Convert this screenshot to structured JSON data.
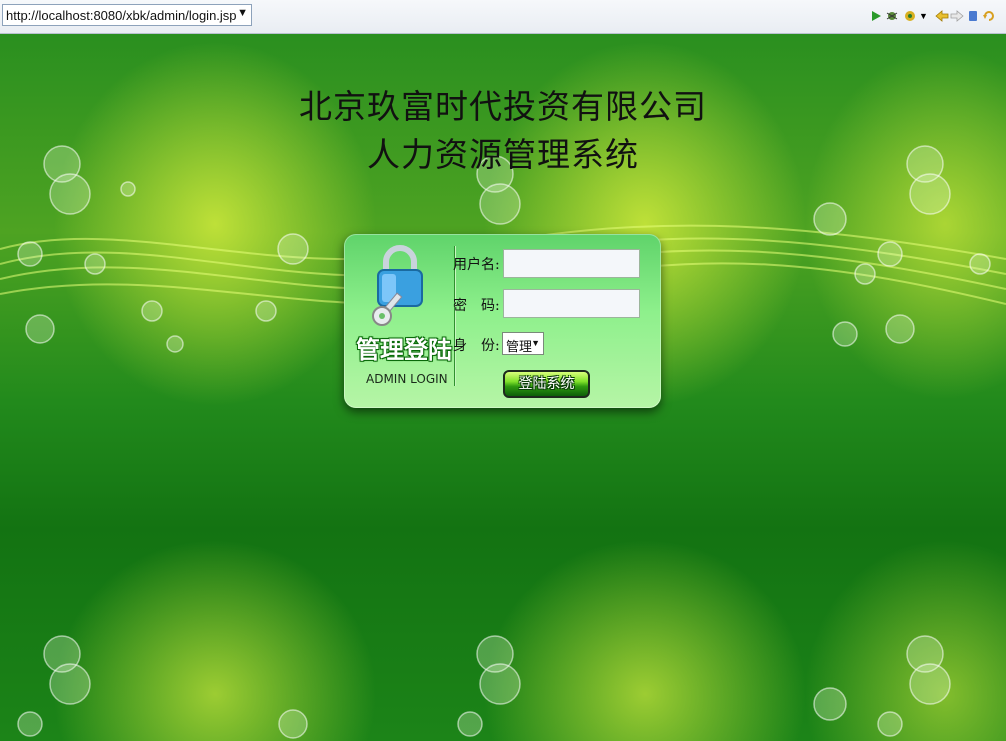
{
  "browser": {
    "url": "http://localhost:8080/xbk/admin/login.jsp",
    "icons": [
      "run-icon",
      "debug-icon",
      "tools-icon",
      "back-icon",
      "forward-icon",
      "stop-icon",
      "refresh-icon"
    ]
  },
  "page": {
    "title_line1": "北京玖富时代投资有限公司",
    "title_line2": "人力资源管理系统"
  },
  "login": {
    "badge_cn": "管理登陆",
    "badge_en": "ADMIN LOGIN",
    "username_label": "用户名:",
    "username_value": "",
    "password_label": "密　码:",
    "password_value": "",
    "role_label": "身　份:",
    "role_selected": "管理",
    "submit_label": "登陆系统"
  },
  "colors": {
    "accent_green": "#2f9a10",
    "panel_green": "#8ef08c"
  }
}
